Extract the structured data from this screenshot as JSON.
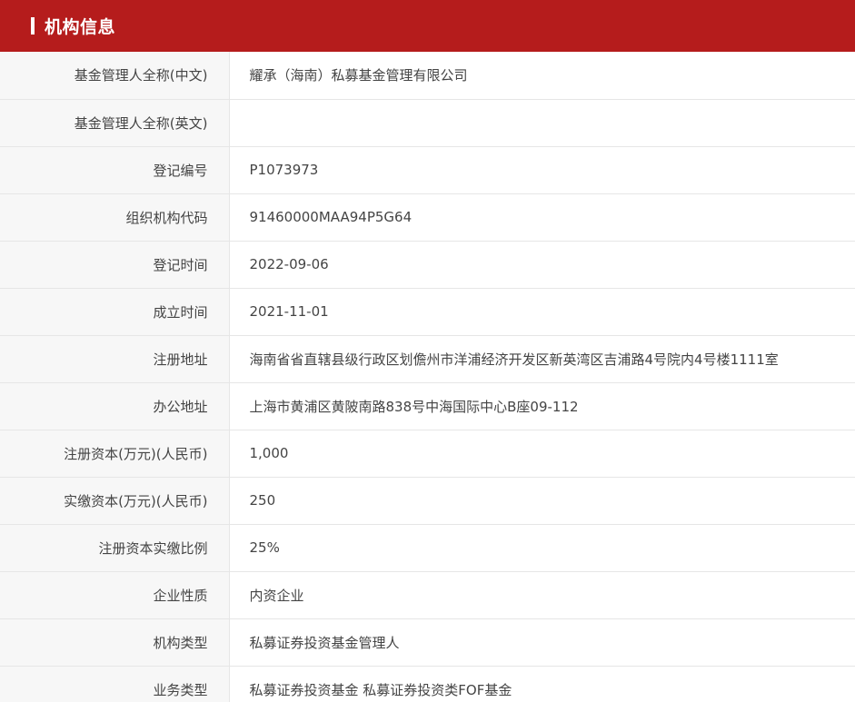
{
  "header": {
    "title": "机构信息"
  },
  "rows": [
    {
      "label": "基金管理人全称(中文)",
      "value": "耀承（海南）私募基金管理有限公司"
    },
    {
      "label": "基金管理人全称(英文)",
      "value": ""
    },
    {
      "label": "登记编号",
      "value": "P1073973"
    },
    {
      "label": "组织机构代码",
      "value": "91460000MAA94P5G64"
    },
    {
      "label": "登记时间",
      "value": "2022-09-06"
    },
    {
      "label": "成立时间",
      "value": "2021-11-01"
    },
    {
      "label": "注册地址",
      "value": "海南省省直辖县级行政区划儋州市洋浦经济开发区新英湾区吉浦路4号院内4号楼1111室"
    },
    {
      "label": "办公地址",
      "value": "上海市黄浦区黄陂南路838号中海国际中心B座09-112"
    },
    {
      "label": "注册资本(万元)(人民币)",
      "value": "1,000"
    },
    {
      "label": "实缴资本(万元)(人民币)",
      "value": "250"
    },
    {
      "label": "注册资本实缴比例",
      "value": "25%"
    },
    {
      "label": "企业性质",
      "value": "内资企业"
    },
    {
      "label": "机构类型",
      "value": "私募证券投资基金管理人"
    },
    {
      "label": "业务类型",
      "value": "私募证券投资基金  私募证券投资类FOF基金"
    }
  ],
  "colors": {
    "header_bg": "#b51c1c",
    "label_bg": "#f7f7f7",
    "border": "#e6e6e6",
    "text": "#4a4a4a"
  }
}
